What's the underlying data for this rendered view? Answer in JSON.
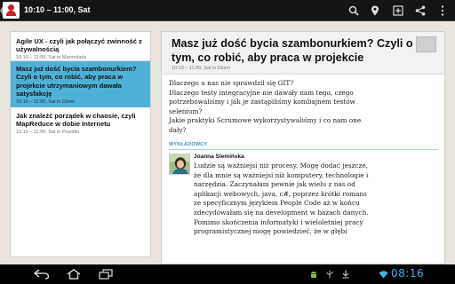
{
  "action_bar": {
    "title": "10:10 – 11:00, Sat",
    "icons": [
      "search-icon",
      "map-pin-icon",
      "add-calendar-icon",
      "share-icon",
      "overflow-menu-icon"
    ]
  },
  "session_list": [
    {
      "title": "Agile UX - czyli jak połączyć zwinność z używalnością",
      "meta": "10:10 – 11:00, Sat in Marmolada",
      "selected": false
    },
    {
      "title": "Masz już dość bycia szambonurkiem? Czyli o tym, co robić, aby praca w projekcie utrzymaniowym dawała satysfakcję",
      "meta": "10:10 – 11:00, Sat in Dżem",
      "selected": true
    },
    {
      "title": "Jak znaleźć porządek w chaosie, czyli MapReduce w dobie Internetu",
      "meta": "10:10 – 11:00, Sat in Powidło",
      "selected": false
    }
  ],
  "article": {
    "title": "Masz już dość bycia szambonurkiem? Czyli o tym, co robić, aby praca w projekcie",
    "meta": "10:10 – 11:00, Sat in Dżem",
    "body": [
      "Dlaczego u nas nie sprawdził się GIT?",
      "Dlaczego testy integracyjne nie dawały nam tego, czego potrzebowaliśmy i jak je zastąpiliśmy kombajnem testów selenium?",
      " Jakie praktyki Scrumowe wykorzystywaliśmy i co nam one dały?"
    ],
    "speakers_label": "WYKŁADOWCY",
    "speaker": {
      "name": "Joanna Siemińska",
      "bio": "Ludzie są ważniejsi niż procesy.  Mogę dodać jeszcze, że dla mnie są ważniejsi niż komputery, technologie i narzędzia. Zaczynałam pewnie jak wielu z nas od aplikacji webowych, java, c#, poprzez krótki romans ze specyficznym językiem People Code aż w końcu zdecydowałam się na development w bazach danych. Pomimo skończenia informatyki i wieloletniej pracy programistycznej mogę powiedzieć, że w głębi"
    }
  },
  "system_bar": {
    "clock": "08:16",
    "nav": [
      "back-icon",
      "home-icon",
      "recent-apps-icon"
    ],
    "status": [
      "android-debug-icon",
      "usb-icon",
      "download-icon",
      "wifi-icon"
    ]
  },
  "colors": {
    "accent": "#3fb5e8",
    "selected_item": "#50b1d8",
    "section_label": "#3b8fc9",
    "background": "#e9e5dd"
  }
}
